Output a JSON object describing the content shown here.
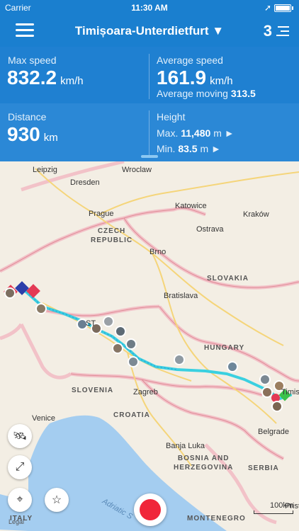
{
  "status_bar": {
    "carrier": "Carrier",
    "time": "11:30 AM"
  },
  "nav": {
    "title": "Timișoara-Unterdietfurt ▼",
    "count": "3"
  },
  "stats": {
    "max_speed": {
      "label": "Max speed",
      "value": "832.2",
      "unit": "km/h"
    },
    "average_speed": {
      "label": "Average speed",
      "value": "161.9",
      "unit": "km/h",
      "moving_label": "Average moving",
      "moving_value": "313.5"
    },
    "distance": {
      "label": "Distance",
      "value": "930",
      "unit": "km"
    },
    "height": {
      "label": "Height",
      "max_label": "Max.",
      "max_value": "11,480",
      "max_unit": "m ►",
      "min_label": "Min.",
      "min_value": "83.5",
      "min_unit": "m ►"
    }
  },
  "map": {
    "cities": {
      "leipzig": "Leipzig",
      "wroclaw": "Wroclaw",
      "dresden": "Dresden",
      "prague": "Prague",
      "katowice": "Katowice",
      "krakow": "Kraków",
      "ostrava": "Ostrava",
      "brno": "Brno",
      "bratislava": "Bratislava",
      "zagreb": "Zagreb",
      "venice": "Venice",
      "banja_luka": "Banja Luka",
      "belgrade": "Belgrade",
      "pristina": "Pristi",
      "timis": "Timis",
      "linz": "ST"
    },
    "countries": {
      "czech": "CZECH\nREPUBLIC",
      "slovakia": "SLOVAKIA",
      "hungary": "HUNGARY",
      "slovenia": "SLOVENIA",
      "croatia": "CROATIA",
      "bosnia": "BOSNIA AND\nHERZEGOVINA",
      "serbia": "SERBIA",
      "italy": "ITALY",
      "montenegro": "MONTENEGRO"
    },
    "sea": "Adriatic S",
    "scale": "100km",
    "legal": "Legal",
    "route_color": "#3ad0e0"
  }
}
